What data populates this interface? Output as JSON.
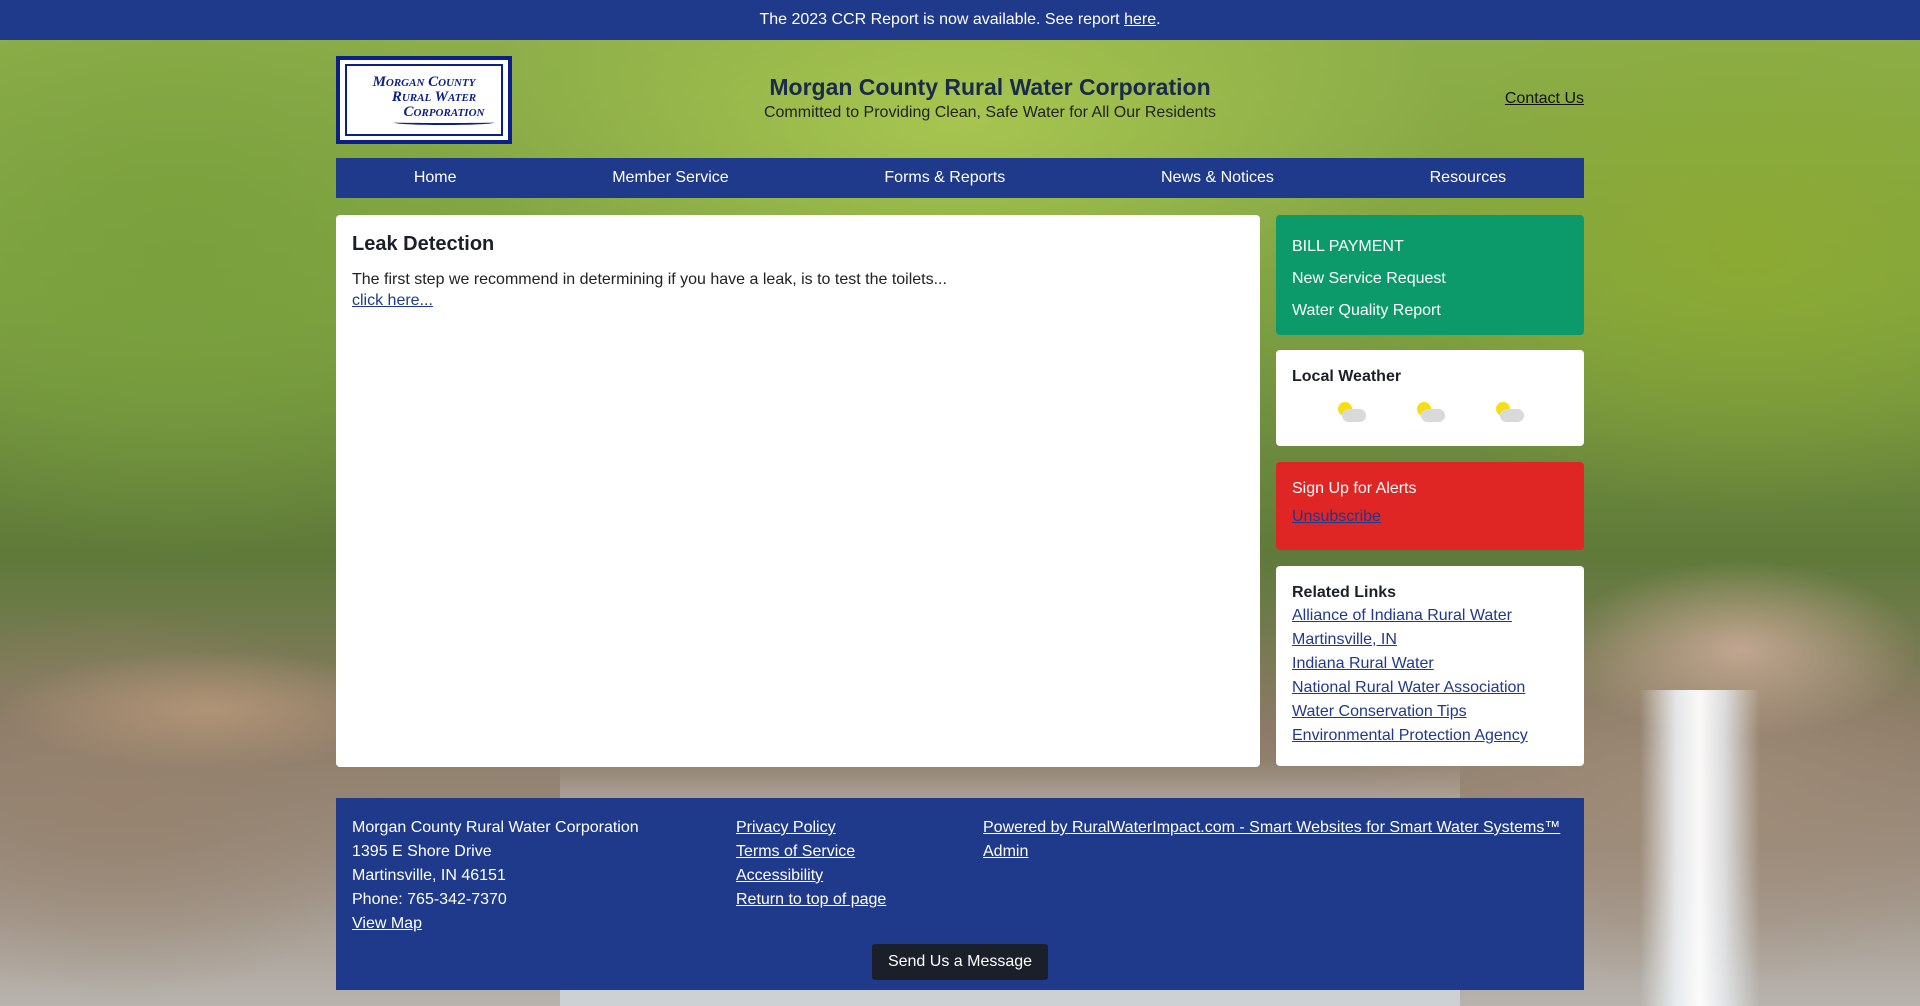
{
  "announcement": {
    "text": "The 2023 CCR Report is now available. See report ",
    "link": "here",
    "suffix": "."
  },
  "header": {
    "logo_lines": [
      "Morgan County",
      "Rural Water",
      "Corporation"
    ],
    "name": "Morgan County Rural Water Corporation",
    "tagline": "Committed to Providing Clean, Safe Water for All Our Residents",
    "contact_link": "Contact Us"
  },
  "nav": {
    "items": [
      "Home",
      "Member Service",
      "Forms & Reports",
      "News & Notices",
      "Resources"
    ]
  },
  "main": {
    "title": "Leak Detection",
    "body": "The first step we recommend in determining if you have a leak, is to test the toilets...",
    "link": "click here..."
  },
  "sidebar": {
    "quick_links": [
      "BILL PAYMENT",
      "New Service Request",
      "Water Quality Report"
    ],
    "weather": {
      "title": "Local Weather",
      "icons": [
        "partly-cloudy-icon",
        "partly-cloudy-icon",
        "partly-cloudy-icon"
      ]
    },
    "alerts": {
      "title": "Sign Up for Alerts",
      "unsubscribe": "Unsubscribe"
    },
    "related": {
      "title": "Related Links",
      "links": [
        "Alliance of Indiana Rural Water",
        "Martinsville, IN",
        "Indiana Rural Water",
        "National Rural Water Association",
        "Water Conservation Tips",
        "Environmental Protection Agency"
      ]
    }
  },
  "footer": {
    "org": "Morgan County Rural Water Corporation",
    "address1": "1395 E Shore Drive",
    "address2": "Martinsville, IN 46151",
    "phone": "Phone: 765-342-7370",
    "map_link": "View Map",
    "links": [
      "Privacy Policy",
      "Terms of Service",
      "Accessibility",
      "Return to top of page"
    ],
    "powered": "Powered by RuralWaterImpact.com - Smart Websites for Smart Water Systems™",
    "admin": "Admin",
    "send_button": "Send Us a Message"
  },
  "colors": {
    "brand_blue": "#1f3a8a",
    "green_panel": "#0d9a6b",
    "red_panel": "#e02525"
  }
}
